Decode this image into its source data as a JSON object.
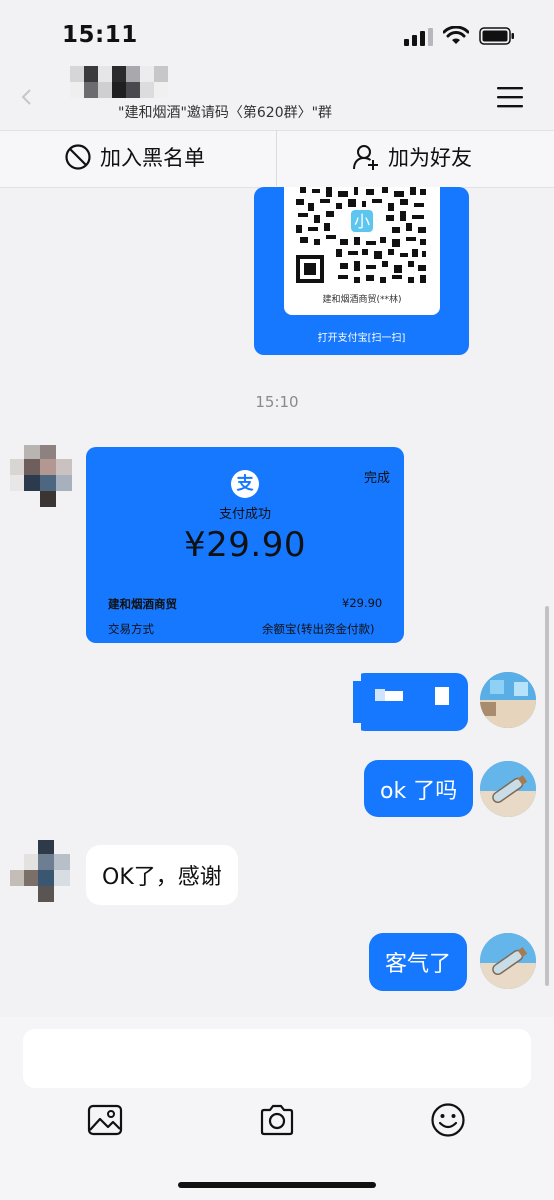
{
  "status_bar": {
    "time": "15:11"
  },
  "header": {
    "subtitle": "\"建和烟酒\"邀请码〈第620群〉\"群"
  },
  "actions": {
    "block_label": "加入黑名单",
    "add_friend_label": "加为好友"
  },
  "messages": {
    "qr_card": {
      "merchant": "建和烟酒商贸(**林)",
      "open_text": "打开支付宝[扫一扫]",
      "qr_center": "小"
    },
    "timestamp": "15:10",
    "payment_card": {
      "logo": "支",
      "status": "完成",
      "title": "支付成功",
      "amount": "¥29.90",
      "merchant": "建和烟酒商贸",
      "amount_small": "¥29.90",
      "method_label": "交易方式",
      "method_value": "余额宝(转出资金付款)"
    },
    "msg_ok": "ok 了吗",
    "msg_thanks": "OK了，感谢",
    "msg_welcome": "客气了"
  },
  "colors": {
    "accent": "#1677ff",
    "background": "#f2f2f4"
  },
  "icons": {
    "block": "block-icon",
    "add_friend": "add-friend-icon",
    "menu": "menu-icon",
    "image": "image-icon",
    "camera": "camera-icon",
    "emoji": "emoji-icon"
  }
}
